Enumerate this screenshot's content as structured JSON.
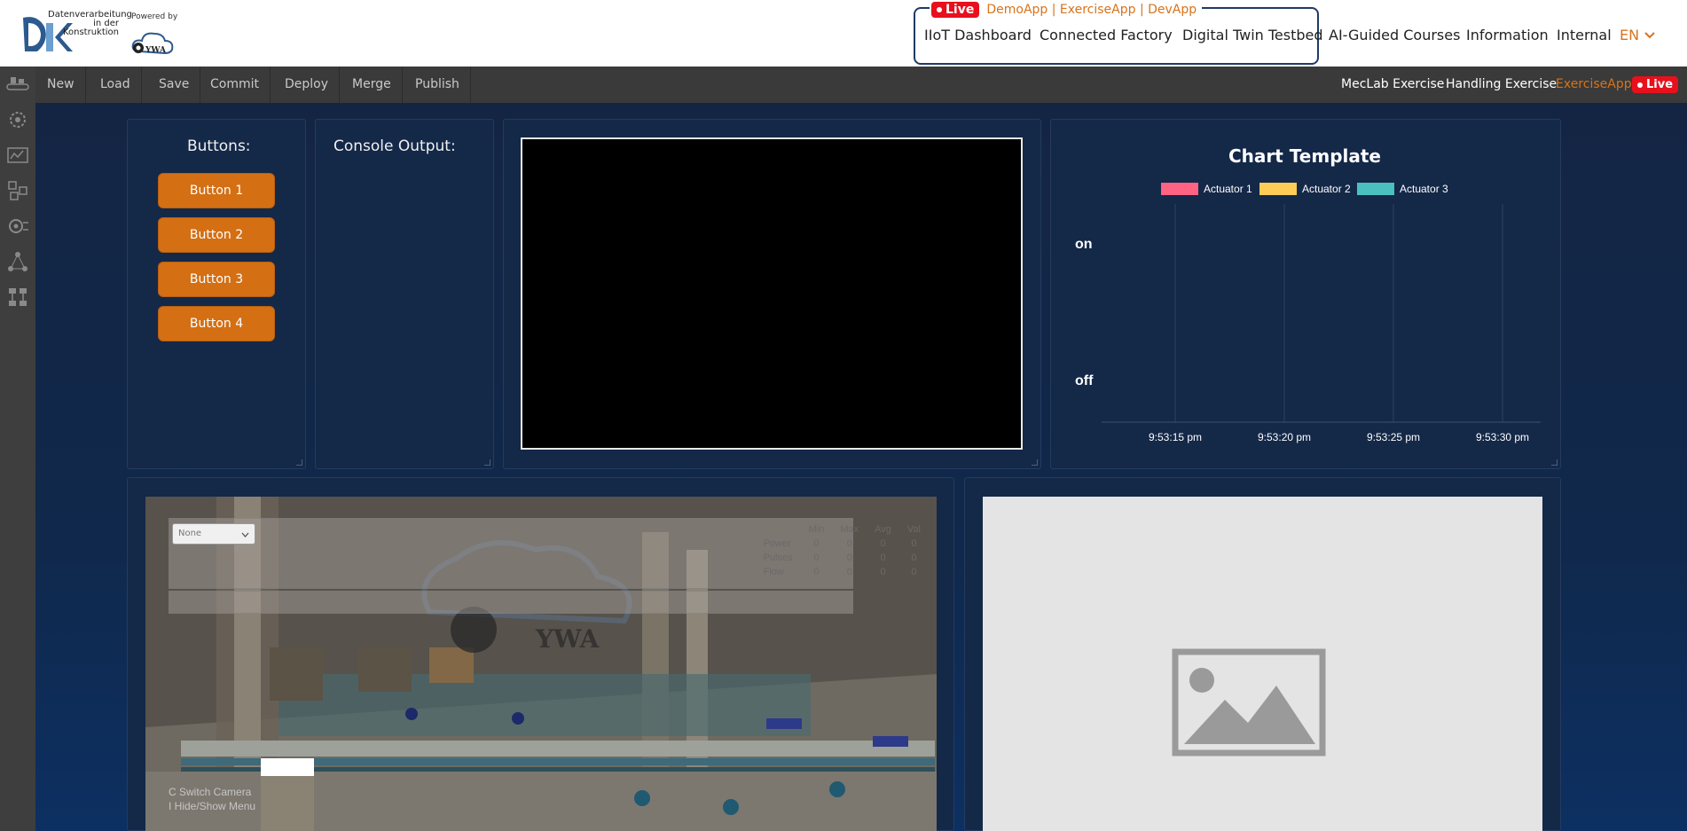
{
  "header": {
    "logo_lines": [
      "Datenverarbeitung",
      "in der",
      "Konstruktion"
    ],
    "powered_by": "Powered by",
    "ywa_logo_text": "YWA",
    "live_badge": "Live",
    "live_apps": "DemoApp | ExerciseApp | DevApp",
    "nav": [
      {
        "label": "IIoT Dashboard"
      },
      {
        "label": "Connected Factory"
      },
      {
        "label": "Digital Twin Testbed"
      },
      {
        "label": "AI-Guided Courses"
      },
      {
        "label": "Information"
      },
      {
        "label": "Internal"
      }
    ],
    "language": "EN"
  },
  "toolbar": {
    "buttons": [
      "New",
      "Load",
      "Save",
      "Commit",
      "Deploy",
      "Merge",
      "Publish"
    ],
    "right": {
      "mecLab": "MecLab Exercise",
      "handling": "Handling Exercise",
      "exerciseApp": "ExerciseApp",
      "live": "Live"
    }
  },
  "sidebar": {
    "icons": [
      "conveyor-icon",
      "gear-dots-icon",
      "factory-icon",
      "blocks-icon",
      "gear-network-icon",
      "network-icon",
      "hierarchy-icon"
    ]
  },
  "buttons_panel": {
    "title": "Buttons:",
    "buttons": [
      "Button 1",
      "Button 2",
      "Button 3",
      "Button 4"
    ]
  },
  "console_panel": {
    "title": "Console Output:"
  },
  "chart_data": {
    "type": "line",
    "title": "Chart Template",
    "series": [
      {
        "name": "Actuator 1",
        "color": "#ff6384",
        "values": []
      },
      {
        "name": "Actuator 2",
        "color": "#ffcd56",
        "values": []
      },
      {
        "name": "Actuator 3",
        "color": "#4bc0c0",
        "values": []
      }
    ],
    "y_categories": [
      "on",
      "off"
    ],
    "x_ticks": [
      "9:53:15 pm",
      "9:53:20 pm",
      "9:53:25 pm",
      "9:53:30 pm"
    ],
    "grid": true,
    "legend_position": "top"
  },
  "viewer": {
    "select_value": "None",
    "table_headers": [
      "Min",
      "Max",
      "Avg",
      "Val"
    ],
    "table_rows": [
      {
        "label": "Power",
        "values": [
          "0",
          "0",
          "0",
          "0"
        ]
      },
      {
        "label": "Pulses",
        "values": [
          "0",
          "0",
          "0",
          "0"
        ]
      },
      {
        "label": "Flow",
        "values": [
          "0",
          "0",
          "0",
          "0"
        ]
      }
    ],
    "hint_line1": "C Switch Camera",
    "hint_line2": "I Hide/Show Menu",
    "watermark": "YWA"
  }
}
